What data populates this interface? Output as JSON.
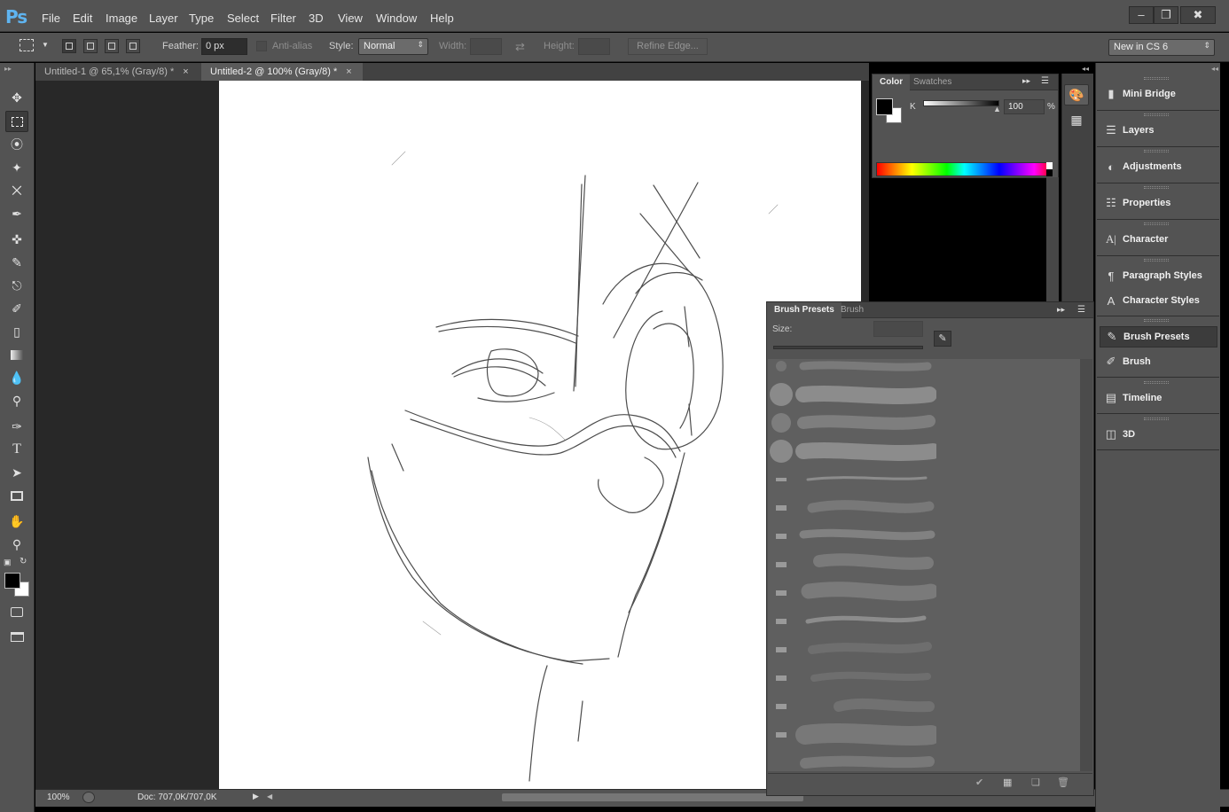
{
  "app": {
    "logo": "Ps",
    "menu": [
      "File",
      "Edit",
      "Image",
      "Layer",
      "Type",
      "Select",
      "Filter",
      "3D",
      "View",
      "Window",
      "Help"
    ],
    "window_controls": [
      "minimize",
      "restore",
      "close"
    ]
  },
  "options_bar": {
    "feather_label": "Feather:",
    "feather_value": "0 px",
    "antialias_label": "Anti-alias",
    "style_label": "Style:",
    "style_value": "Normal",
    "width_label": "Width:",
    "height_label": "Height:",
    "refine_label": "Refine Edge...",
    "workspace_value": "New in CS 6"
  },
  "tools": [
    "move-tool",
    "rect-marquee-tool",
    "lasso-tool",
    "quick-select-tool",
    "crop-tool",
    "eyedropper-tool",
    "healing-brush-tool",
    "brush-tool",
    "clone-stamp-tool",
    "history-brush-tool",
    "eraser-tool",
    "gradient-tool",
    "blur-tool",
    "dodge-tool",
    "pen-tool",
    "type-tool",
    "path-select-tool",
    "rectangle-tool",
    "hand-tool",
    "zoom-tool"
  ],
  "tabs": [
    {
      "label": "Untitled-1 @ 65,1% (Gray/8) *",
      "close": "×",
      "active": false
    },
    {
      "label": "Untitled-2 @ 100% (Gray/8) *",
      "close": "×",
      "active": true
    }
  ],
  "status": {
    "zoom": "100%",
    "doc": "Doc: 707,0K/707,0K"
  },
  "color_panel": {
    "tabs": [
      "Color",
      "Swatches"
    ],
    "channel": "K",
    "value": "100",
    "unit": "%",
    "foreground": "#000000",
    "background": "#ffffff"
  },
  "right_dock": [
    {
      "label": "Mini Bridge",
      "icon": "mini-bridge-icon"
    },
    {
      "label": "Layers",
      "icon": "layers-icon"
    },
    {
      "label": "Adjustments",
      "icon": "adjustments-icon"
    },
    {
      "label": "Properties",
      "icon": "properties-icon"
    },
    {
      "label": "Character",
      "icon": "character-icon"
    },
    {
      "label": "Paragraph Styles",
      "icon": "paragraph-styles-icon"
    },
    {
      "label": "Character Styles",
      "icon": "character-styles-icon"
    },
    {
      "label": "Brush Presets",
      "icon": "brush-presets-icon"
    },
    {
      "label": "Brush",
      "icon": "brush-icon"
    },
    {
      "label": "Timeline",
      "icon": "timeline-icon"
    },
    {
      "label": "3D",
      "icon": "3d-icon"
    }
  ],
  "brush_panel": {
    "tabs": [
      "Brush Presets",
      "Brush"
    ],
    "size_label": "Size:"
  }
}
